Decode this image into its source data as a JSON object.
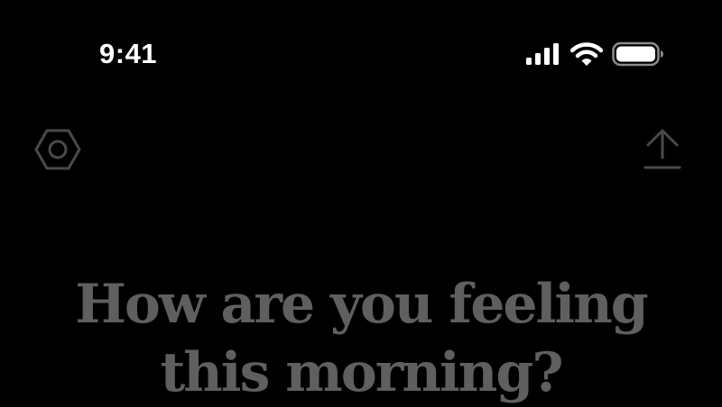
{
  "status_bar": {
    "time": "9:41",
    "icons": [
      "cellular-signal-icon",
      "wifi-icon",
      "battery-icon"
    ],
    "text_color": "#ffffff"
  },
  "toolbar": {
    "left_icon": "settings-hexagon-icon",
    "right_icon": "share-upload-icon",
    "icon_color": "#4a4a4a"
  },
  "prompt": {
    "line1": "How are you feeling",
    "line2": "this morning?",
    "color": "#5f5f5f"
  },
  "theme": {
    "background": "#000000"
  }
}
